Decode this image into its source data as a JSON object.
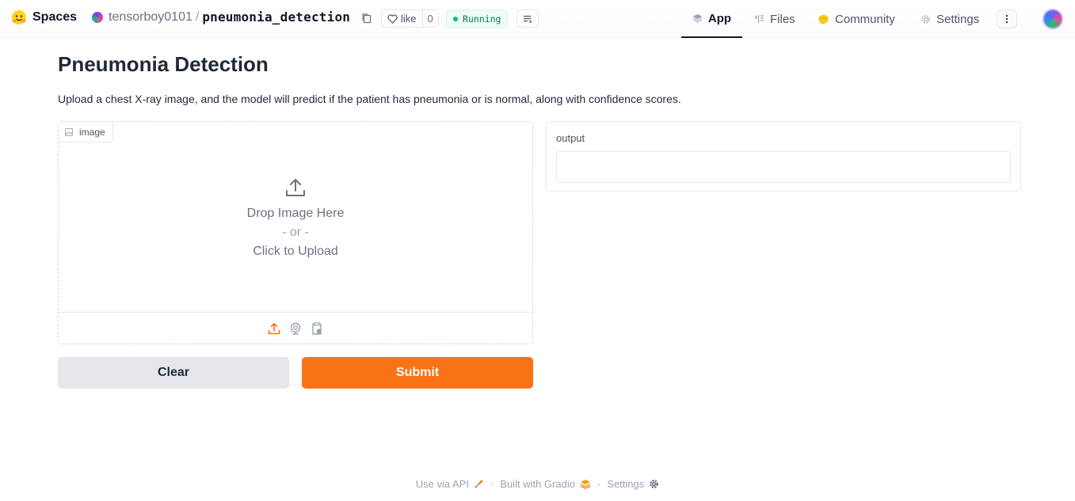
{
  "header": {
    "brand": "Spaces",
    "owner": "tensorboy0101",
    "separator": "/",
    "repo_name": "pneumonia_detection",
    "like_label": "like",
    "like_count": "0",
    "status": "Running",
    "status_color": "#10b981",
    "tabs": [
      {
        "label": "App",
        "icon": "cube-icon",
        "active": true
      },
      {
        "label": "Files",
        "icon": "files-icon"
      },
      {
        "label": "Community",
        "icon": "community-icon"
      },
      {
        "label": "Settings",
        "icon": "gear-icon"
      }
    ]
  },
  "main": {
    "title": "Pneumonia Detection",
    "description": "Upload a chest X-ray image, and the model will predict if the patient has pneumonia or is normal, along with confidence scores.",
    "image_input": {
      "label": "image",
      "drop_text": "Drop Image Here",
      "or_text": "- or -",
      "click_text": "Click to Upload",
      "sources": [
        "upload-icon",
        "webcam-icon",
        "clipboard-icon"
      ]
    },
    "output": {
      "label": "output",
      "value": ""
    },
    "buttons": {
      "clear": "Clear",
      "submit": "Submit"
    },
    "accent_color": "#f97316"
  },
  "footer": {
    "api": "Use via API",
    "sep": "·",
    "built": "Built with Gradio",
    "settings": "Settings"
  }
}
